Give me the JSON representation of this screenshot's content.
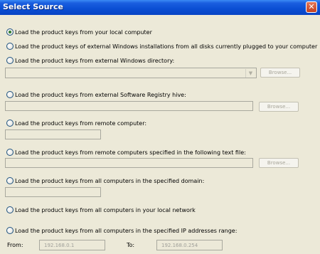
{
  "window": {
    "title": "Select Source",
    "close_icon": "✕"
  },
  "options": [
    {
      "label": "Load the product keys from your local computer",
      "checked": true
    },
    {
      "label": "Load the product keys of external Windows installations from all disks currently plugged to your computer",
      "checked": false
    },
    {
      "label": "Load the product keys from external Windows directory:",
      "checked": false
    },
    {
      "label": "Load the product keys from external Software Registry hive:",
      "checked": false
    },
    {
      "label": "Load the product keys from remote computer:",
      "checked": false
    },
    {
      "label": "Load the product keys from remote computers specified in the following text file:",
      "checked": false
    },
    {
      "label": "Load the product keys from all computers in the specified domain:",
      "checked": false
    },
    {
      "label": "Load the product keys from all computers in your local network",
      "checked": false
    },
    {
      "label": "Load the product keys from all computers in the specified IP addresses range:",
      "checked": false
    }
  ],
  "browse_label": "Browse...",
  "dropdown_icon": "chevron-down-icon",
  "dropdown_glyph": "▼",
  "ip_range": {
    "from_label": "From:",
    "from_value": "192.168.0.1",
    "to_label": "To:",
    "to_value": "192.168.0.254"
  }
}
